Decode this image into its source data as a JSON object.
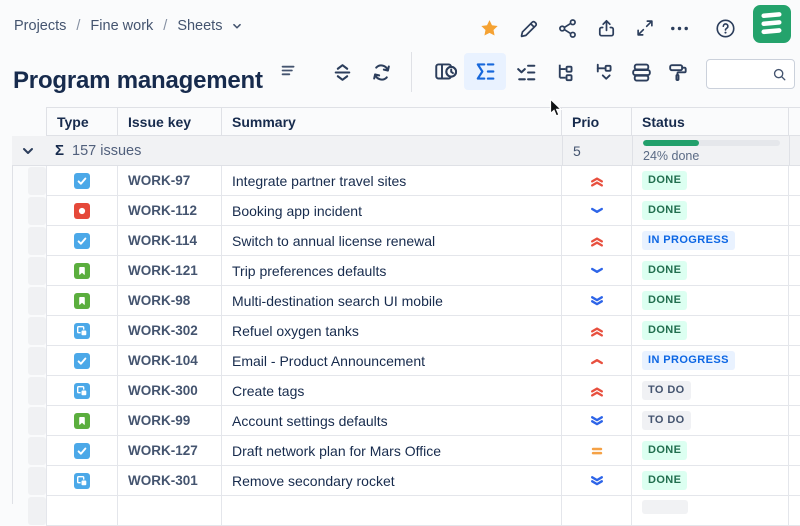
{
  "breadcrumb": {
    "items": [
      "Projects",
      "Fine work",
      "Sheets"
    ],
    "separator": "/"
  },
  "header": {
    "title": "Program management"
  },
  "topbar": {
    "icons": [
      "favorite-star",
      "edit-pencil",
      "share",
      "export",
      "fullscreen",
      "more",
      "help",
      "structure-logo"
    ]
  },
  "toolbar": {
    "buttons": [
      "expand-collapse-all",
      "refresh",
      "views",
      "sum-columns",
      "checklist",
      "hierarchy",
      "expand-subtree",
      "rows-grouping",
      "format-painter"
    ],
    "active_button": "sum-columns",
    "search": {
      "value": "",
      "placeholder": ""
    }
  },
  "table": {
    "columns": [
      "Type",
      "Issue key",
      "Summary",
      "Prio",
      "Status"
    ],
    "summary_row": {
      "sigma": "Σ",
      "label": "157 issues",
      "prio_total": "5",
      "progress_percent": 24,
      "progress_label": "24% done",
      "bar_fill_percent": 41
    },
    "rows": [
      {
        "type": "task",
        "key": "WORK-97",
        "summary": "Integrate partner travel sites",
        "priority": "highest",
        "status": "DONE"
      },
      {
        "type": "incident",
        "key": "WORK-112",
        "summary": "Booking app incident",
        "priority": "low",
        "status": "DONE"
      },
      {
        "type": "task",
        "key": "WORK-114",
        "summary": "Switch to annual license renewal",
        "priority": "highest",
        "status": "IN PROGRESS"
      },
      {
        "type": "story",
        "key": "WORK-121",
        "summary": "Trip preferences defaults",
        "priority": "low",
        "status": "DONE"
      },
      {
        "type": "story",
        "key": "WORK-98",
        "summary": "Multi-destination search UI mobile",
        "priority": "lowest",
        "status": "DONE"
      },
      {
        "type": "subtask",
        "key": "WORK-302",
        "summary": "Refuel oxygen tanks",
        "priority": "highest",
        "status": "DONE"
      },
      {
        "type": "task",
        "key": "WORK-104",
        "summary": "Email - Product Announcement",
        "priority": "high",
        "status": "IN PROGRESS"
      },
      {
        "type": "subtask",
        "key": "WORK-300",
        "summary": "Create tags",
        "priority": "highest",
        "status": "TO DO"
      },
      {
        "type": "story",
        "key": "WORK-99",
        "summary": "Account settings defaults",
        "priority": "lowest",
        "status": "TO DO"
      },
      {
        "type": "task",
        "key": "WORK-127",
        "summary": "Draft network plan for Mars Office",
        "priority": "medium",
        "status": "DONE"
      },
      {
        "type": "subtask",
        "key": "WORK-301",
        "summary": "Remove secondary rocket",
        "priority": "lowest",
        "status": "DONE"
      }
    ]
  },
  "colors": {
    "accent_blue": "#1868DB",
    "active_button_bg": "#E9F2FF",
    "logo_green": "#24A36C",
    "star_orange": "#F5A233",
    "progress_green": "#22A06B",
    "priority": {
      "highest": "#E8503F",
      "high": "#E8503F",
      "medium": "#F5A145",
      "low": "#2E65E8",
      "lowest": "#2E65E8"
    },
    "type": {
      "task": "#4BA8E8",
      "story": "#5BAE3E",
      "incident": "#E5493A",
      "subtask": "#4BA8E8"
    },
    "status": {
      "DONE": {
        "bg": "#DCFFF1",
        "fg": "#216E4E"
      },
      "IN PROGRESS": {
        "bg": "#E9F2FF",
        "fg": "#0C66E4"
      },
      "TO DO": {
        "bg": "#F0F1F4",
        "fg": "#44546F"
      }
    }
  }
}
